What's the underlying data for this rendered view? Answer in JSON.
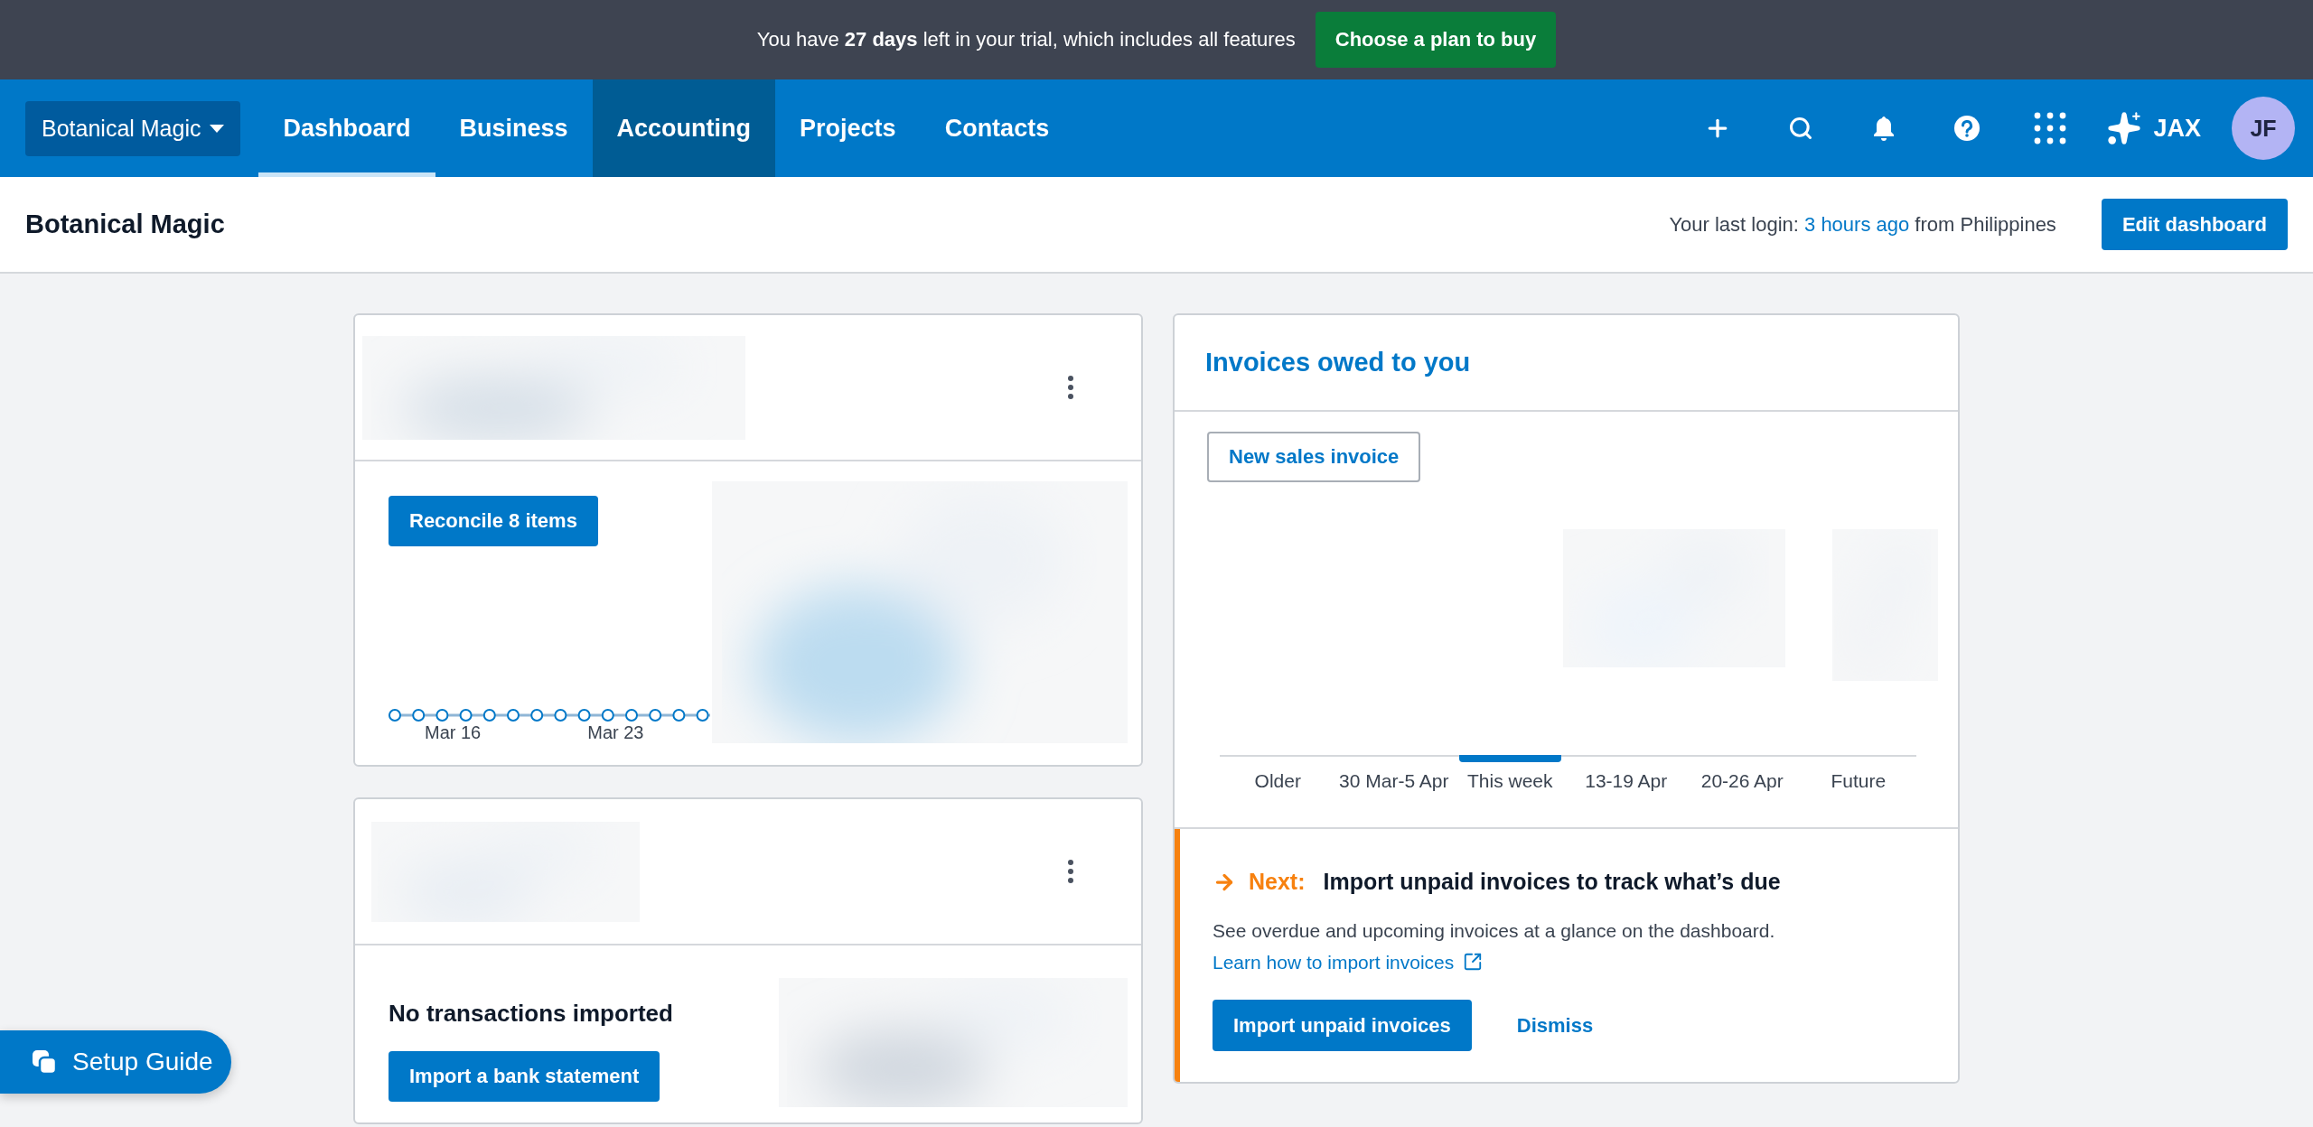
{
  "trial_banner": {
    "message": "You have **27 days** left in your trial, which includes all features",
    "button": "Choose a plan to buy"
  },
  "nav": {
    "org_switcher": "Botanical Magic",
    "tabs": [
      {
        "label": "Dashboard",
        "selected": true,
        "highlighted": false
      },
      {
        "label": "Business",
        "selected": false,
        "highlighted": false
      },
      {
        "label": "Accounting",
        "selected": false,
        "highlighted": true
      },
      {
        "label": "Projects",
        "selected": false,
        "highlighted": false
      },
      {
        "label": "Contacts",
        "selected": false,
        "highlighted": false
      }
    ],
    "assistant": "JAX",
    "avatar": "JF"
  },
  "header": {
    "title": "Botanical Magic",
    "last_login": {
      "prefix": "Your last login:",
      "link": "3 hours ago",
      "suffix": "from Philippines"
    },
    "button": "Edit dashboard"
  },
  "bank_cards": [
    {
      "kind": "reconcile",
      "button": "Reconcile 8 items",
      "dates": [
        "Mar 16",
        "Mar 23"
      ]
    },
    {
      "kind": "empty",
      "message": "No transactions imported",
      "button": "Import a bank statement"
    }
  ],
  "invoices": {
    "title": "Invoices owed to you",
    "button": "New sales invoice",
    "periods": [
      {
        "label": "Older",
        "selected": false
      },
      {
        "label": "30 Mar-5 Apr",
        "selected": false
      },
      {
        "label": "This week",
        "selected": true
      },
      {
        "label": "13-19 Apr",
        "selected": false
      },
      {
        "label": "20-26 Apr",
        "selected": false
      },
      {
        "label": "Future",
        "selected": false
      }
    ],
    "next": {
      "label": "Next:",
      "title": "Import unpaid invoices to track what’s due",
      "text": "See overdue and upcoming invoices at a glance on the dashboard.",
      "link": "Learn how to import invoices",
      "button": "Import unpaid invoices",
      "dismiss": "Dismiss"
    }
  },
  "setup_guide": "Setup Guide"
}
